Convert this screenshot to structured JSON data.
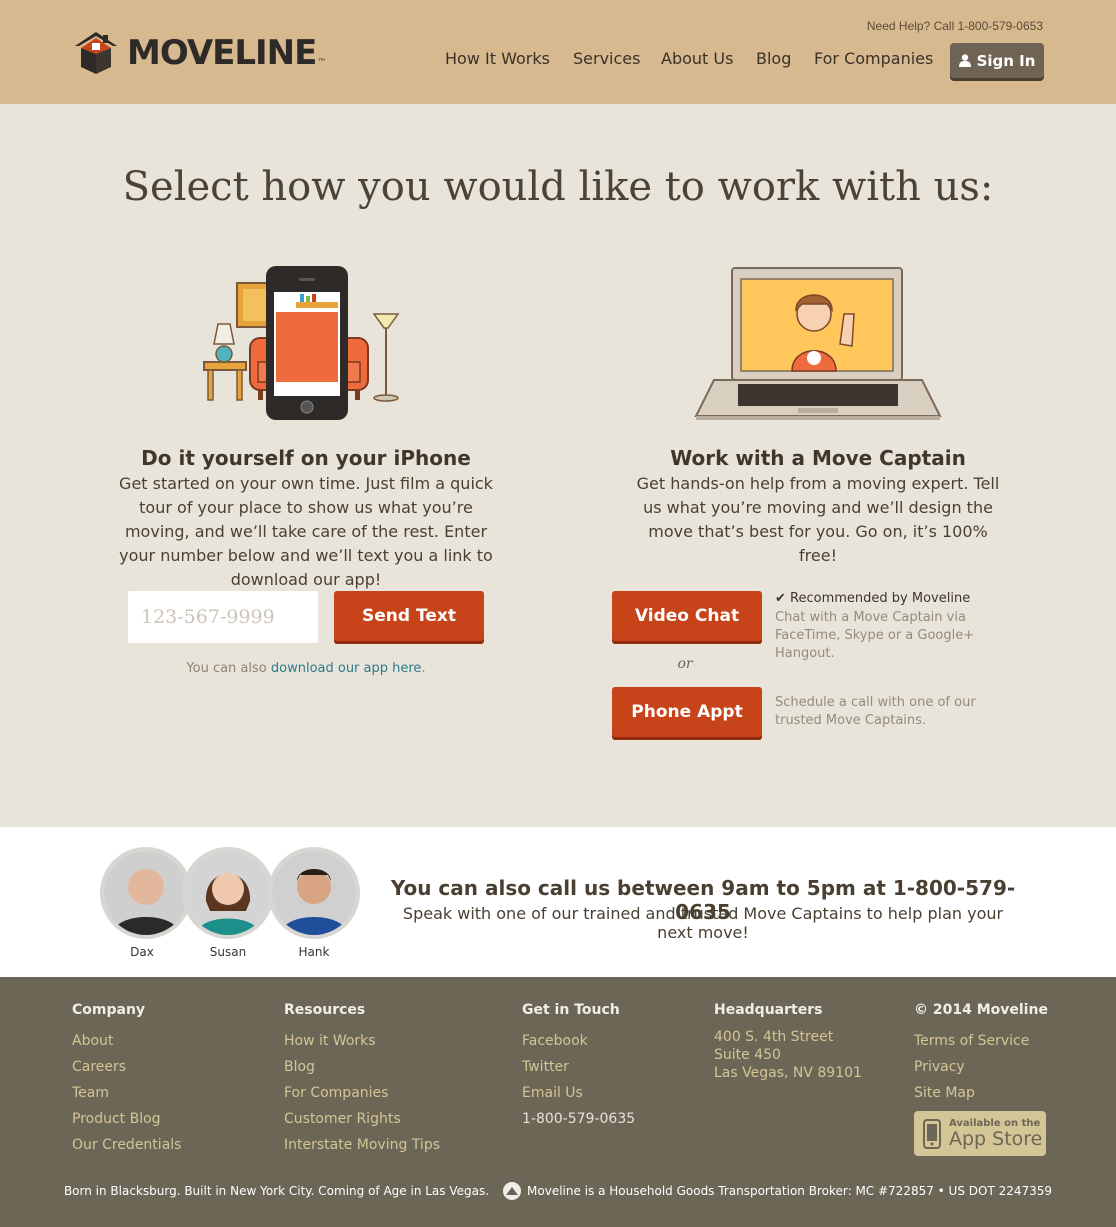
{
  "header": {
    "brand": "MOVELINE",
    "trademark": "™",
    "help_text": "Need Help? Call 1-800-579-0653",
    "nav": [
      "How It Works",
      "Services",
      "About Us",
      "Blog",
      "For Companies"
    ],
    "signin_label": "Sign In"
  },
  "main": {
    "headline": "Select how you would like to work with us:",
    "diy": {
      "title": "Do it yourself on your iPhone",
      "text": "Get started on your own time. Just film a quick tour of your place to show us what you’re moving, and we’ll take care of the rest. Enter your number below and we’ll text you a link to download our app!",
      "phone_placeholder": "123-567-9999",
      "send_label": "Send Text",
      "also_prefix": "You can also ",
      "also_link": "download our app here",
      "also_suffix": "."
    },
    "captain": {
      "title": "Work with a Move Captain",
      "text": "Get hands-on help from a moving expert. Tell us what you’re moving and we’ll design the move that’s best for you. Go on, it’s 100% free!",
      "video_label": "Video Chat",
      "recommended": "Recommended by Moveline",
      "video_desc": "Chat with a Move Captain via FaceTime, Skype or a Google+ Hangout.",
      "or": "or",
      "phone_label": "Phone Appt",
      "phone_desc": "Schedule a call with one of our trusted Move Captains."
    }
  },
  "call": {
    "people": [
      "Dax",
      "Susan",
      "Hank"
    ],
    "title": "You can also call us between 9am to 5pm at 1-800-579-0635",
    "subtitle": "Speak with one of our trained and trusted Move Captains to help plan your next move!"
  },
  "footer": {
    "company": {
      "heading": "Company",
      "links": [
        "About",
        "Careers",
        "Team",
        "Product Blog",
        "Our Credentials"
      ]
    },
    "resources": {
      "heading": "Resources",
      "links": [
        "How it Works",
        "Blog",
        "For Companies",
        "Customer Rights",
        "Interstate Moving Tips"
      ]
    },
    "touch": {
      "heading": "Get in Touch",
      "links": [
        "Facebook",
        "Twitter",
        "Email Us"
      ],
      "phone": "1-800-579-0635"
    },
    "hq": {
      "heading": "Headquarters",
      "lines": [
        "400 S. 4th Street",
        "Suite 450",
        "Las Vegas, NV 89101"
      ]
    },
    "legal": {
      "heading": "© 2014 Moveline",
      "links": [
        "Terms of Service",
        "Privacy",
        "Site Map"
      ]
    },
    "appstore_small": "Available on the",
    "appstore_big": "App Store",
    "bottom_left": "Born in Blacksburg. Built in New York City. Coming of Age in Las Vegas.",
    "bottom_right": "Moveline is a Household Goods Transportation Broker:  MC #722857  •  US DOT 2247359"
  },
  "colors": {
    "header_bg": "#d7b98f",
    "page_bg": "#e9e4da",
    "accent_red": "#c7441b",
    "footer_bg": "#6c6656",
    "footer_link": "#d4c596",
    "link_teal": "#2d7b8c"
  }
}
